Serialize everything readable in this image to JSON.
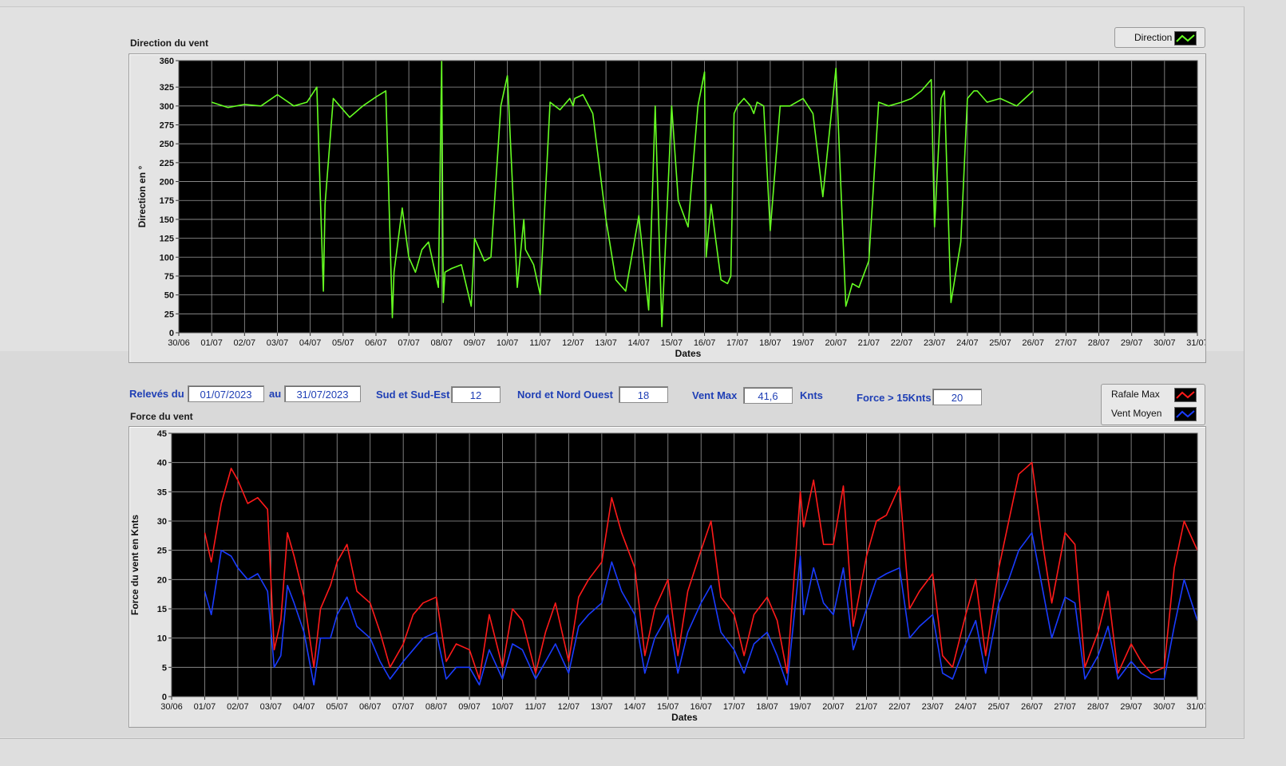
{
  "colors": {
    "direction_line": "#66ff22",
    "rafale_line": "#ff1a1a",
    "moyen_line": "#1a3cff",
    "plot_bg": "#000000",
    "grid": "#9a9a9a",
    "label_blue": "#1f3fb5"
  },
  "top_chart": {
    "title": "Direction du vent",
    "legend": [
      "Direction"
    ]
  },
  "controls": {
    "releves_label": "Relevés du",
    "date_from": "01/07/2023",
    "au_label": "au",
    "date_to": "31/07/2023",
    "sud_label": "Sud et Sud-Est",
    "sud_value": "12",
    "nord_label": "Nord et Nord Ouest",
    "nord_value": "18",
    "ventmax_label": "Vent Max",
    "ventmax_value": "41,6",
    "knts_label": "Knts",
    "force15_label": "Force > 15Knts",
    "force15_value": "20"
  },
  "bottom_chart": {
    "title": "Force du vent",
    "legend": [
      "Rafale Max",
      "Vent Moyen"
    ]
  },
  "chart_data": [
    {
      "type": "line",
      "title": "Direction du vent",
      "xlabel": "Dates",
      "ylabel": "Direction en °",
      "ylim": [
        0,
        360
      ],
      "yticks": [
        0,
        25,
        50,
        75,
        100,
        125,
        150,
        175,
        200,
        225,
        250,
        275,
        300,
        325,
        360
      ],
      "xticks": [
        "30/06",
        "01/07",
        "02/07",
        "03/07",
        "04/07",
        "05/07",
        "06/07",
        "07/07",
        "08/07",
        "09/07",
        "10/07",
        "11/07",
        "12/07",
        "13/07",
        "14/07",
        "15/07",
        "16/07",
        "17/07",
        "18/07",
        "19/07",
        "20/07",
        "21/07",
        "22/07",
        "23/07",
        "24/07",
        "25/07",
        "26/07",
        "27/07",
        "28/07",
        "29/07",
        "30/07",
        "31/07"
      ],
      "grid": true,
      "legend_placement": "top-right",
      "series": [
        {
          "name": "Direction",
          "x_days": [
            1.0,
            1.5,
            2.0,
            2.5,
            3.0,
            3.5,
            3.9,
            4.2,
            4.4,
            4.45,
            4.7,
            4.9,
            5.2,
            5.6,
            6.0,
            6.3,
            6.5,
            6.55,
            6.8,
            7.0,
            7.2,
            7.4,
            7.6,
            7.9,
            8.0,
            8.05,
            8.1,
            8.3,
            8.6,
            8.9,
            9.0,
            9.3,
            9.5,
            9.8,
            10.0,
            10.3,
            10.5,
            10.55,
            10.8,
            11.0,
            11.3,
            11.6,
            11.9,
            12.0,
            12.05,
            12.3,
            12.6,
            13.0,
            13.3,
            13.6,
            14.0,
            14.3,
            14.5,
            14.7,
            15.0,
            15.2,
            15.5,
            15.8,
            16.0,
            16.05,
            16.2,
            16.5,
            16.7,
            16.8,
            16.9,
            17.0,
            17.2,
            17.4,
            17.5,
            17.6,
            17.8,
            18.0,
            18.3,
            18.6,
            19.0,
            19.3,
            19.6,
            20.0,
            20.3,
            20.5,
            20.7,
            21.0,
            21.3,
            21.6,
            22.0,
            22.3,
            22.6,
            22.9,
            23.0,
            23.2,
            23.3,
            23.5,
            23.8,
            24.0,
            24.2,
            24.3,
            24.6,
            25.0,
            25.5,
            26.0,
            26.5,
            27.0,
            27.2,
            27.4,
            27.5,
            27.7,
            28.0,
            28.05,
            28.2,
            28.5,
            28.8,
            29.0,
            29.3,
            29.5,
            29.8,
            30.0,
            30.3,
            30.5,
            30.8,
            31.0
          ],
          "values": [
            305,
            298,
            302,
            300,
            315,
            300,
            305,
            325,
            55,
            170,
            310,
            300,
            285,
            300,
            312,
            320,
            20,
            80,
            165,
            100,
            80,
            110,
            120,
            60,
            360,
            40,
            80,
            85,
            90,
            35,
            125,
            95,
            100,
            300,
            340,
            60,
            150,
            110,
            90,
            50,
            305,
            295,
            310,
            300,
            310,
            315,
            290,
            150,
            70,
            55,
            155,
            30,
            300,
            8,
            300,
            175,
            140,
            300,
            345,
            100,
            170,
            70,
            65,
            75,
            290,
            300,
            310,
            300,
            290,
            305,
            300,
            135,
            300,
            300,
            310,
            290,
            180,
            350,
            35,
            65,
            60,
            95,
            305,
            300,
            305,
            310,
            320,
            335,
            140,
            310,
            320,
            40,
            120,
            310,
            320,
            320,
            305,
            310,
            300,
            320
          ]
        }
      ]
    },
    {
      "type": "line",
      "title": "Force du vent",
      "xlabel": "Dates",
      "ylabel": "Force du vent en Knts",
      "ylim": [
        0,
        45
      ],
      "yticks": [
        0,
        5,
        10,
        15,
        20,
        25,
        30,
        35,
        40,
        45
      ],
      "xticks": [
        "30/06",
        "01/07",
        "02/07",
        "03/07",
        "04/07",
        "05/07",
        "06/07",
        "07/07",
        "08/07",
        "09/07",
        "10/07",
        "11/07",
        "12/07",
        "13/07",
        "14/07",
        "15/07",
        "16/07",
        "17/07",
        "18/07",
        "19/07",
        "20/07",
        "21/07",
        "22/07",
        "23/07",
        "24/07",
        "25/07",
        "26/07",
        "27/07",
        "28/07",
        "29/07",
        "30/07",
        "31/07"
      ],
      "grid": true,
      "legend_placement": "top-right",
      "series": [
        {
          "name": "Rafale Max",
          "x_days": [
            1.0,
            1.2,
            1.5,
            1.8,
            2.0,
            2.3,
            2.6,
            2.9,
            3.1,
            3.3,
            3.5,
            3.7,
            4.0,
            4.3,
            4.5,
            4.8,
            5.0,
            5.3,
            5.6,
            6.0,
            6.3,
            6.6,
            7.0,
            7.3,
            7.6,
            8.0,
            8.3,
            8.6,
            9.0,
            9.3,
            9.6,
            10.0,
            10.3,
            10.6,
            11.0,
            11.3,
            11.6,
            12.0,
            12.3,
            12.6,
            13.0,
            13.3,
            13.6,
            14.0,
            14.3,
            14.6,
            15.0,
            15.3,
            15.6,
            16.0,
            16.3,
            16.6,
            17.0,
            17.3,
            17.6,
            18.0,
            18.3,
            18.6,
            19.0,
            19.1,
            19.4,
            19.7,
            20.0,
            20.3,
            20.6,
            21.0,
            21.3,
            21.6,
            22.0,
            22.3,
            22.6,
            23.0,
            23.3,
            23.6,
            24.0,
            24.3,
            24.6,
            25.0,
            25.3,
            25.6,
            26.0,
            26.3,
            26.6,
            27.0,
            27.3,
            27.6,
            28.0,
            28.3,
            28.6,
            29.0,
            29.3,
            29.6,
            30.0,
            30.3,
            30.6,
            31.0
          ],
          "values": [
            28,
            23,
            33,
            39,
            37,
            33,
            34,
            32,
            8,
            13,
            28,
            24,
            17,
            5,
            15,
            19,
            23,
            26,
            18,
            16,
            11,
            5,
            9,
            14,
            16,
            17,
            6,
            9,
            8,
            3,
            14,
            5,
            15,
            13,
            4,
            11,
            16,
            6,
            17,
            20,
            23,
            34,
            28,
            22,
            7,
            15,
            20,
            7,
            18,
            25,
            30,
            17,
            14,
            7,
            14,
            17,
            13,
            4,
            35,
            29,
            37,
            26,
            26,
            36,
            12,
            24,
            30,
            31,
            36,
            15,
            18,
            21,
            7,
            5,
            14,
            20,
            7,
            22,
            30,
            38,
            40,
            27,
            16,
            28,
            26,
            5,
            11,
            18,
            4,
            9,
            6,
            4,
            5,
            22,
            30,
            25
          ]
        },
        {
          "name": "Vent Moyen",
          "x_days": [
            1.0,
            1.2,
            1.5,
            1.8,
            2.0,
            2.3,
            2.6,
            2.9,
            3.1,
            3.3,
            3.5,
            3.7,
            4.0,
            4.3,
            4.5,
            4.8,
            5.0,
            5.3,
            5.6,
            6.0,
            6.3,
            6.6,
            7.0,
            7.3,
            7.6,
            8.0,
            8.3,
            8.6,
            9.0,
            9.3,
            9.6,
            10.0,
            10.3,
            10.6,
            11.0,
            11.3,
            11.6,
            12.0,
            12.3,
            12.6,
            13.0,
            13.3,
            13.6,
            14.0,
            14.3,
            14.6,
            15.0,
            15.3,
            15.6,
            16.0,
            16.3,
            16.6,
            17.0,
            17.3,
            17.6,
            18.0,
            18.3,
            18.6,
            19.0,
            19.1,
            19.4,
            19.7,
            20.0,
            20.3,
            20.6,
            21.0,
            21.3,
            21.6,
            22.0,
            22.3,
            22.6,
            23.0,
            23.3,
            23.6,
            24.0,
            24.3,
            24.6,
            25.0,
            25.3,
            25.6,
            26.0,
            26.3,
            26.6,
            27.0,
            27.3,
            27.6,
            28.0,
            28.3,
            28.6,
            29.0,
            29.3,
            29.6,
            30.0,
            30.3,
            30.6,
            31.0
          ],
          "values": [
            18,
            14,
            25,
            24,
            22,
            20,
            21,
            18,
            5,
            7,
            19,
            16,
            11,
            2,
            10,
            10,
            14,
            17,
            12,
            10,
            6,
            3,
            6,
            8,
            10,
            11,
            3,
            5,
            5,
            2,
            8,
            3,
            9,
            8,
            3,
            6,
            9,
            4,
            12,
            14,
            16,
            23,
            18,
            14,
            4,
            10,
            14,
            4,
            11,
            16,
            19,
            11,
            8,
            4,
            9,
            11,
            7,
            2,
            24,
            14,
            22,
            16,
            14,
            22,
            8,
            15,
            20,
            21,
            22,
            10,
            12,
            14,
            4,
            3,
            9,
            13,
            4,
            16,
            20,
            25,
            28,
            19,
            10,
            17,
            16,
            3,
            7,
            12,
            3,
            6,
            4,
            3,
            3,
            12,
            20,
            13
          ]
        }
      ]
    }
  ]
}
